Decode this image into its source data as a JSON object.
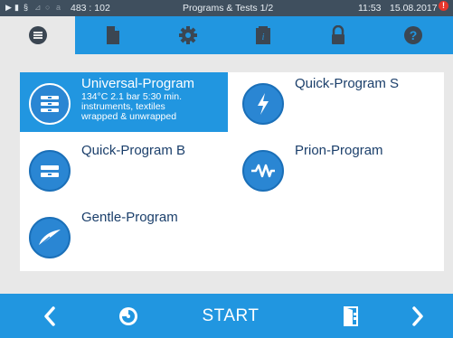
{
  "status": {
    "coords": "483 : 102",
    "title": "Programs & Tests 1/2",
    "time": "11:53",
    "date": "15.08.2017"
  },
  "tabs": [
    {
      "name": "list-icon",
      "active": true
    },
    {
      "name": "document-icon",
      "active": false
    },
    {
      "name": "gear-icon",
      "active": false
    },
    {
      "name": "info-book-icon",
      "active": false
    },
    {
      "name": "lock-icon",
      "active": false
    },
    {
      "name": "help-icon",
      "active": false
    }
  ],
  "programs": [
    {
      "title": "Universal-Program",
      "desc1": "134°C 2.1 bar 5:30 min.",
      "desc2": "instruments, textiles",
      "desc3": "wrapped & unwrapped",
      "selected": true,
      "icon": "stack-trays-icon"
    },
    {
      "title": "Quick-Program S",
      "selected": false,
      "icon": "lightning-icon"
    },
    {
      "title": "Quick-Program B",
      "selected": false,
      "icon": "tray-icon"
    },
    {
      "title": "Prion-Program",
      "selected": false,
      "icon": "wave-icon"
    },
    {
      "title": "Gentle-Program",
      "selected": false,
      "icon": "feather-icon"
    }
  ],
  "footer": {
    "start_label": "START",
    "prev_icon": "chevron-left-icon",
    "timer_icon": "timer-icon",
    "door_icon": "door-icon",
    "next_icon": "chevron-right-icon"
  },
  "colors": {
    "accent": "#2196e0",
    "statusbar": "#3f4f5e",
    "title_text": "#1b3f6b"
  }
}
